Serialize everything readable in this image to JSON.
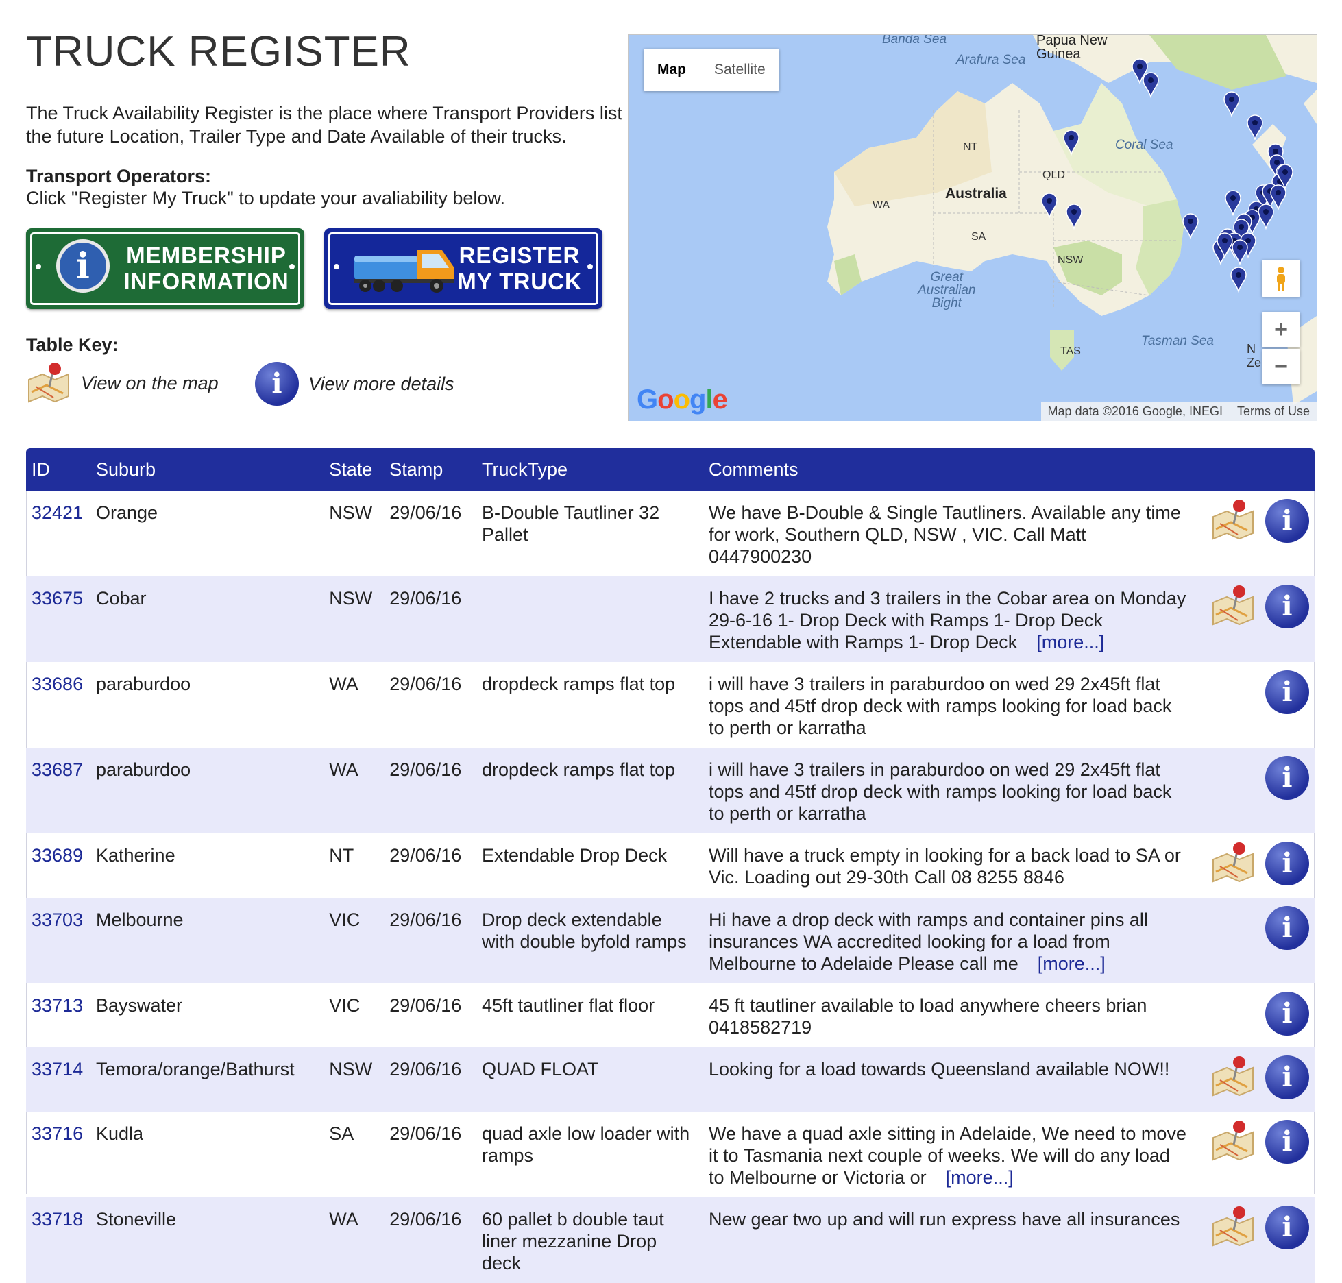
{
  "page": {
    "title": "TRUCK REGISTER",
    "intro": "The Truck Availability Register is the place where Transport Providers list the future Location, Trailer Type and Date Available of their trucks.",
    "operators_heading": "Transport Operators:",
    "operators_text": "Click \"Register My Truck\" to update your avaliability below."
  },
  "buttons": {
    "membership_line1": "MEMBERSHIP",
    "membership_line2": "INFORMATION",
    "register_line1": "REGISTER",
    "register_line2": "MY TRUCK"
  },
  "table_key": {
    "heading": "Table Key:",
    "map_label": "View on the map",
    "details_label": "View more details"
  },
  "map": {
    "map_tab": "Map",
    "satellite_tab": "Satellite",
    "labels": {
      "banda": "Banda Sea",
      "arafura": "Arafura Sea",
      "png": "Papua New\nGuinea",
      "coral": "Coral Sea",
      "nt": "NT",
      "qld": "QLD",
      "wa": "WA",
      "australia": "Australia",
      "sa": "SA",
      "nsw": "NSW",
      "bight": "Great\nAustralian\nBight",
      "tas": "TAS",
      "tasman": "Tasman Sea",
      "nz": "N\nZe"
    },
    "zoom_in": "+",
    "zoom_out": "−",
    "google": "Google",
    "attribution": "Map data ©2016 Google, INEGI",
    "terms": "Terms of Use",
    "colors": {
      "water": "#a9c9f5",
      "land": "#f3f0e0",
      "green": "#c9dfa6",
      "pin": "#2a3a9c"
    }
  },
  "table": {
    "headers": {
      "id": "ID",
      "suburb": "Suburb",
      "state": "State",
      "stamp": "Stamp",
      "trucktype": "TruckType",
      "comments": "Comments"
    },
    "more_label": "[more...]",
    "rows": [
      {
        "id": "32421",
        "suburb": "Orange",
        "state": "NSW",
        "stamp": "29/06/16",
        "trucktype": "B-Double Tautliner 32 Pallet",
        "comments": "We have B-Double & Single Tautliners. Available any time for work, Southern QLD, NSW , VIC. Call Matt 0447900230",
        "more": false,
        "has_map": true
      },
      {
        "id": "33675",
        "suburb": "Cobar",
        "state": "NSW",
        "stamp": "29/06/16",
        "trucktype": "",
        "comments": "I have 2 trucks and 3 trailers in the Cobar area on Monday 29-6-16 1- Drop Deck with Ramps 1- Drop Deck Extendable with Ramps 1- Drop Deck",
        "more": true,
        "has_map": true
      },
      {
        "id": "33686",
        "suburb": "paraburdoo",
        "state": "WA",
        "stamp": "29/06/16",
        "trucktype": "dropdeck ramps flat top",
        "comments": "i will have 3 trailers in paraburdoo on wed 29 2x45ft flat tops and 45tf drop deck with ramps looking for load back to perth or karratha",
        "more": false,
        "has_map": false
      },
      {
        "id": "33687",
        "suburb": "paraburdoo",
        "state": "WA",
        "stamp": "29/06/16",
        "trucktype": "dropdeck ramps flat top",
        "comments": "i will have 3 trailers in paraburdoo on wed 29 2x45ft flat tops and 45tf drop deck with ramps looking for load back to perth or karratha",
        "more": false,
        "has_map": false
      },
      {
        "id": "33689",
        "suburb": "Katherine",
        "state": "NT",
        "stamp": "29/06/16",
        "trucktype": "Extendable Drop Deck",
        "comments": "Will have a truck empty in looking for a back load to SA or Vic. Loading out 29-30th Call 08 8255 8846",
        "more": false,
        "has_map": true
      },
      {
        "id": "33703",
        "suburb": "Melbourne",
        "state": "VIC",
        "stamp": "29/06/16",
        "trucktype": "Drop deck extendable with double byfold ramps",
        "comments": "Hi have a drop deck with ramps and container pins all insurances WA accredited looking for a load from Melbourne to Adelaide Please call me",
        "more": true,
        "has_map": false
      },
      {
        "id": "33713",
        "suburb": "Bayswater",
        "state": "VIC",
        "stamp": "29/06/16",
        "trucktype": "45ft tautliner flat floor",
        "comments": "45 ft tautliner available to load anywhere cheers brian 0418582719",
        "more": false,
        "has_map": false
      },
      {
        "id": "33714",
        "suburb": "Temora/orange/Bathurst",
        "state": "NSW",
        "stamp": "29/06/16",
        "trucktype": "QUAD FLOAT",
        "comments": "Looking for a load towards Queensland available NOW!!",
        "more": false,
        "has_map": true
      },
      {
        "id": "33716",
        "suburb": "Kudla",
        "state": "SA",
        "stamp": "29/06/16",
        "trucktype": "quad axle low loader with ramps",
        "comments": "We have a quad axle sitting in Adelaide, We need to move it to Tasmania next couple of weeks. We will do any load to Melbourne or Victoria or",
        "more": true,
        "has_map": true
      },
      {
        "id": "33718",
        "suburb": "Stoneville",
        "state": "WA",
        "stamp": "29/06/16",
        "trucktype": "60 pallet b double taut liner mezzanine Drop deck",
        "comments": "New gear two up and will run express have all insurances",
        "more": false,
        "has_map": true
      }
    ]
  }
}
